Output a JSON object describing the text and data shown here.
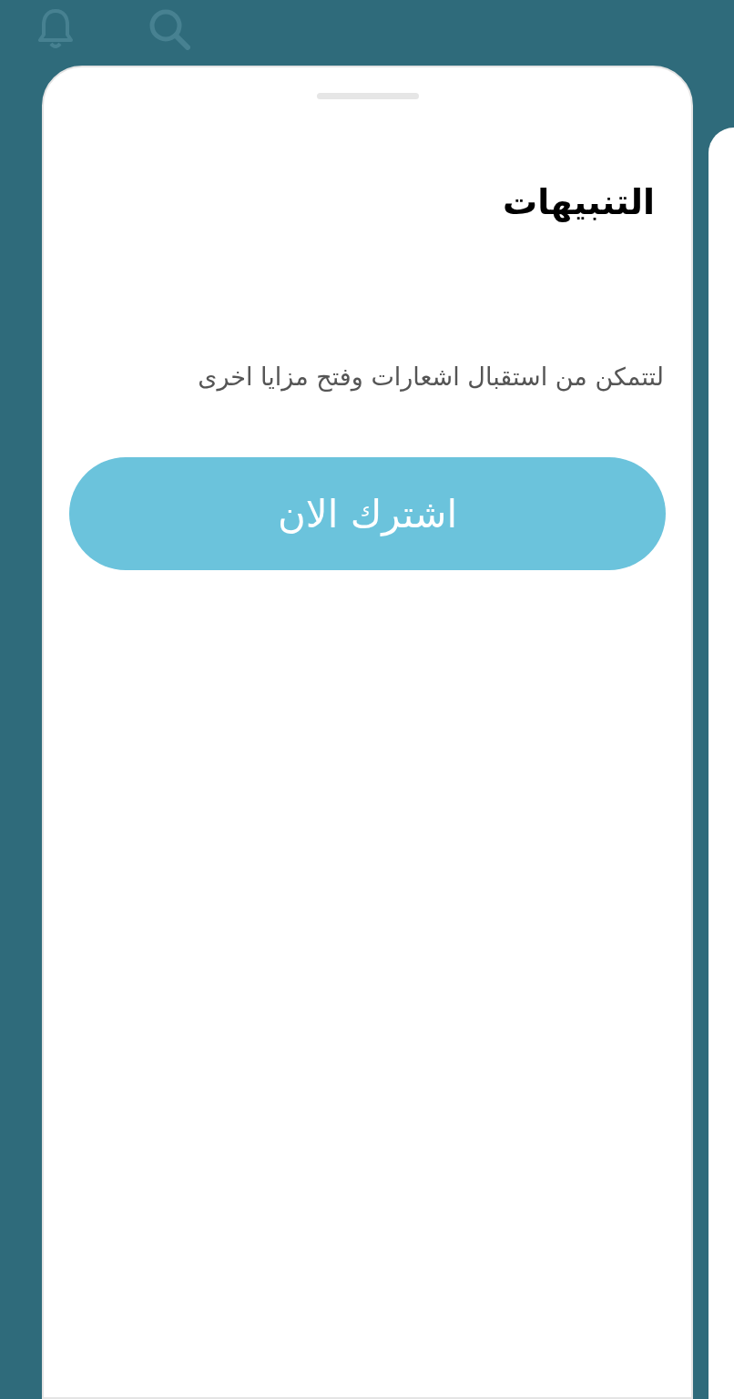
{
  "sheet": {
    "title": "التنبيهات",
    "message": "لتتمكن من استقبال اشعارات وفتح مزايا اخرى",
    "subscribe_button": "اشترك الان"
  }
}
